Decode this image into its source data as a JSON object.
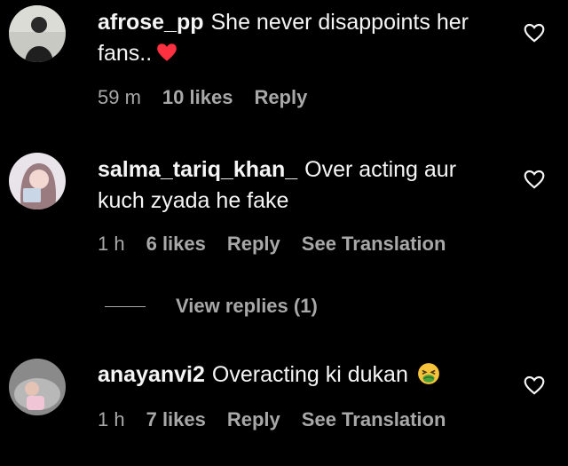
{
  "comments": [
    {
      "username": "afrose_pp",
      "text": "She never disappoints her fans..",
      "emoji": "red-heart",
      "time": "59 m",
      "likes": "10 likes",
      "reply": "Reply",
      "translation": ""
    },
    {
      "username": "salma_tariq_khan_",
      "text": "Over acting aur kuch zyada he fake",
      "emoji": "",
      "time": "1 h",
      "likes": "6 likes",
      "reply": "Reply",
      "translation": "See Translation",
      "view_replies": "View replies (1)"
    },
    {
      "username": "anayanvi2",
      "text": "Overacting ki dukan",
      "emoji": "nauseated-face",
      "time": "1 h",
      "likes": "7 likes",
      "reply": "Reply",
      "translation": "See Translation"
    }
  ],
  "colors": {
    "background": "#000000",
    "text": "#f5f5f5",
    "secondary": "#a8a8a8",
    "heart_emoji": "#ff3040",
    "nauseated_emoji": "#f6c33b"
  },
  "icons": {
    "like": "heart-outline-icon"
  }
}
